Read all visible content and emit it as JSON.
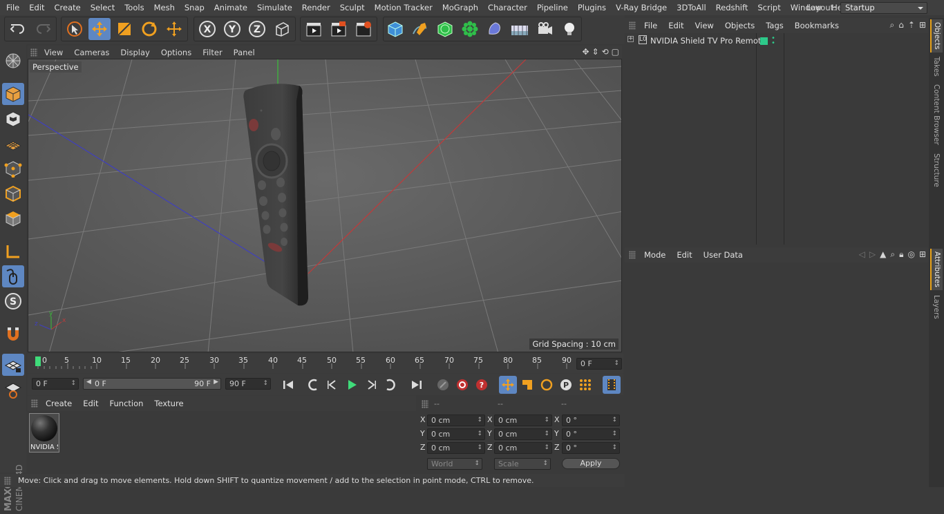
{
  "menubar": {
    "items": [
      "File",
      "Edit",
      "Create",
      "Select",
      "Tools",
      "Mesh",
      "Snap",
      "Animate",
      "Simulate",
      "Render",
      "Sculpt",
      "Motion Tracker",
      "MoGraph",
      "Character",
      "Pipeline",
      "Plugins",
      "V-Ray Bridge",
      "3DToAll",
      "Redshift",
      "Script",
      "Window",
      "Help"
    ],
    "layout_label": "Layout:",
    "layout_value": "Startup"
  },
  "viewport": {
    "menu": [
      "View",
      "Cameras",
      "Display",
      "Options",
      "Filter",
      "Panel"
    ],
    "camera_label": "Perspective",
    "grid_spacing": "Grid Spacing : 10 cm"
  },
  "timeline": {
    "ticks": [
      "0",
      "5",
      "10",
      "15",
      "20",
      "25",
      "30",
      "35",
      "40",
      "45",
      "50",
      "55",
      "60",
      "65",
      "70",
      "75",
      "80",
      "85",
      "90"
    ],
    "current_frame": "0 F"
  },
  "transport": {
    "start_field": "0 F",
    "range_start": "0 F",
    "range_end": "90 F",
    "end_field": "90 F"
  },
  "material": {
    "menu": [
      "Create",
      "Edit",
      "Function",
      "Texture"
    ],
    "item_name": "NVIDIA S"
  },
  "coords": {
    "headers": [
      "--",
      "--",
      "--"
    ],
    "rows": [
      {
        "axis": "X",
        "pos": "0 cm",
        "size": "0 cm",
        "rot": "0 °"
      },
      {
        "axis": "Y",
        "pos": "0 cm",
        "size": "0 cm",
        "rot": "0 °"
      },
      {
        "axis": "Z",
        "pos": "0 cm",
        "size": "0 cm",
        "rot": "0 °"
      }
    ],
    "mode_world": "World",
    "mode_scale": "Scale",
    "apply": "Apply"
  },
  "status": "Move: Click and drag to move elements. Hold down SHIFT to quantize movement / add to the selection in point mode, CTRL to remove.",
  "objects": {
    "menu": [
      "File",
      "Edit",
      "View",
      "Objects",
      "Tags",
      "Bookmarks"
    ],
    "items": [
      {
        "name": "NVIDIA Shield TV Pro Remote",
        "layer_color": "#2dc98a"
      }
    ]
  },
  "attributes": {
    "menu": [
      "Mode",
      "Edit",
      "User Data"
    ]
  },
  "side_tabs": [
    "Objects",
    "Takes",
    "Content Browser",
    "Structure",
    "Attributes",
    "Layers"
  ],
  "brand": {
    "line1": "MAXON",
    "line2": "CINEMA 4D"
  },
  "colors": {
    "accent": "#5e87c2",
    "active_tab": "#e8a21a",
    "x_axis": "#c93a3a",
    "z_axis": "#3a3ac9",
    "y_axis": "#3ac93a"
  }
}
